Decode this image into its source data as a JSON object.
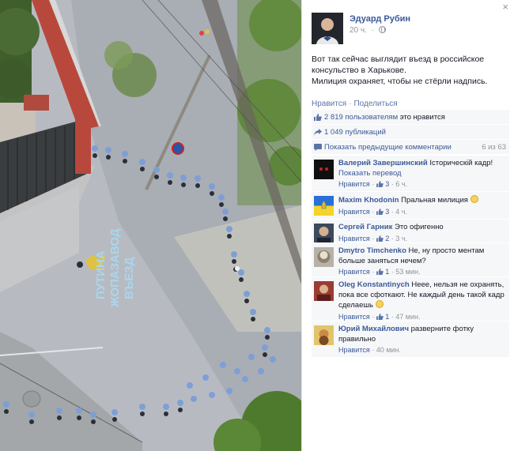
{
  "post": {
    "author": "Эдуард Рубин",
    "time": "20 ч.",
    "text_lines": [
      "Вот так сейчас выглядит въезд в российское",
      "консульство в Харькове.",
      "Милиция охраняет, чтобы не стёрли надпись."
    ],
    "like_link": "Нравится",
    "share_link": "Поделиться",
    "close_glyph": "×"
  },
  "photo": {
    "graffiti_line1": "ВЪЕЗД",
    "graffiti_line2": "ЖОПАЗАВОД",
    "graffiti_line3": "ПУТИНА"
  },
  "ufi": {
    "likes_link": "2 819 пользователям",
    "likes_text": " это нравится",
    "shares_link": "1 049 публикаций",
    "prev_comments": "Показать предыдущие комментарии",
    "count": "6 из 63"
  },
  "comments": [
    {
      "name": "Валерий Завершинский",
      "text": "Історическій кадр!",
      "translate": "Показать перевод",
      "like": "Нравится",
      "likes": "3",
      "time": "6 ч."
    },
    {
      "name": "Maxim Khodonin",
      "text": "Пральная милиция",
      "like": "Нравится",
      "likes": "3",
      "time": "4 ч."
    },
    {
      "name": "Сергей Гарник",
      "text": "Это офигенно",
      "like": "Нравится",
      "likes": "2",
      "time": "3 ч."
    },
    {
      "name": "Dmytro Timchenko",
      "text": "Не, ну просто ментам больше заняться нечем?",
      "like": "Нравится",
      "likes": "1",
      "time": "53 мин."
    },
    {
      "name": "Oleg Konstantinych",
      "text": "Нееe, нельзя не охранять, пока все сфоткают. Не каждый день такой кадр сделаешь",
      "like": "Нравится",
      "likes": "1",
      "time": "47 мин."
    },
    {
      "name": "Юрий Михайлович",
      "text": "разверните фотку правильно",
      "like": "Нравится",
      "time": "40 мин."
    }
  ],
  "colors": {
    "link": "#3b5998",
    "muted": "#90949c",
    "ufi_bg": "#f6f7f9",
    "uniform": "#7e9fd6"
  }
}
